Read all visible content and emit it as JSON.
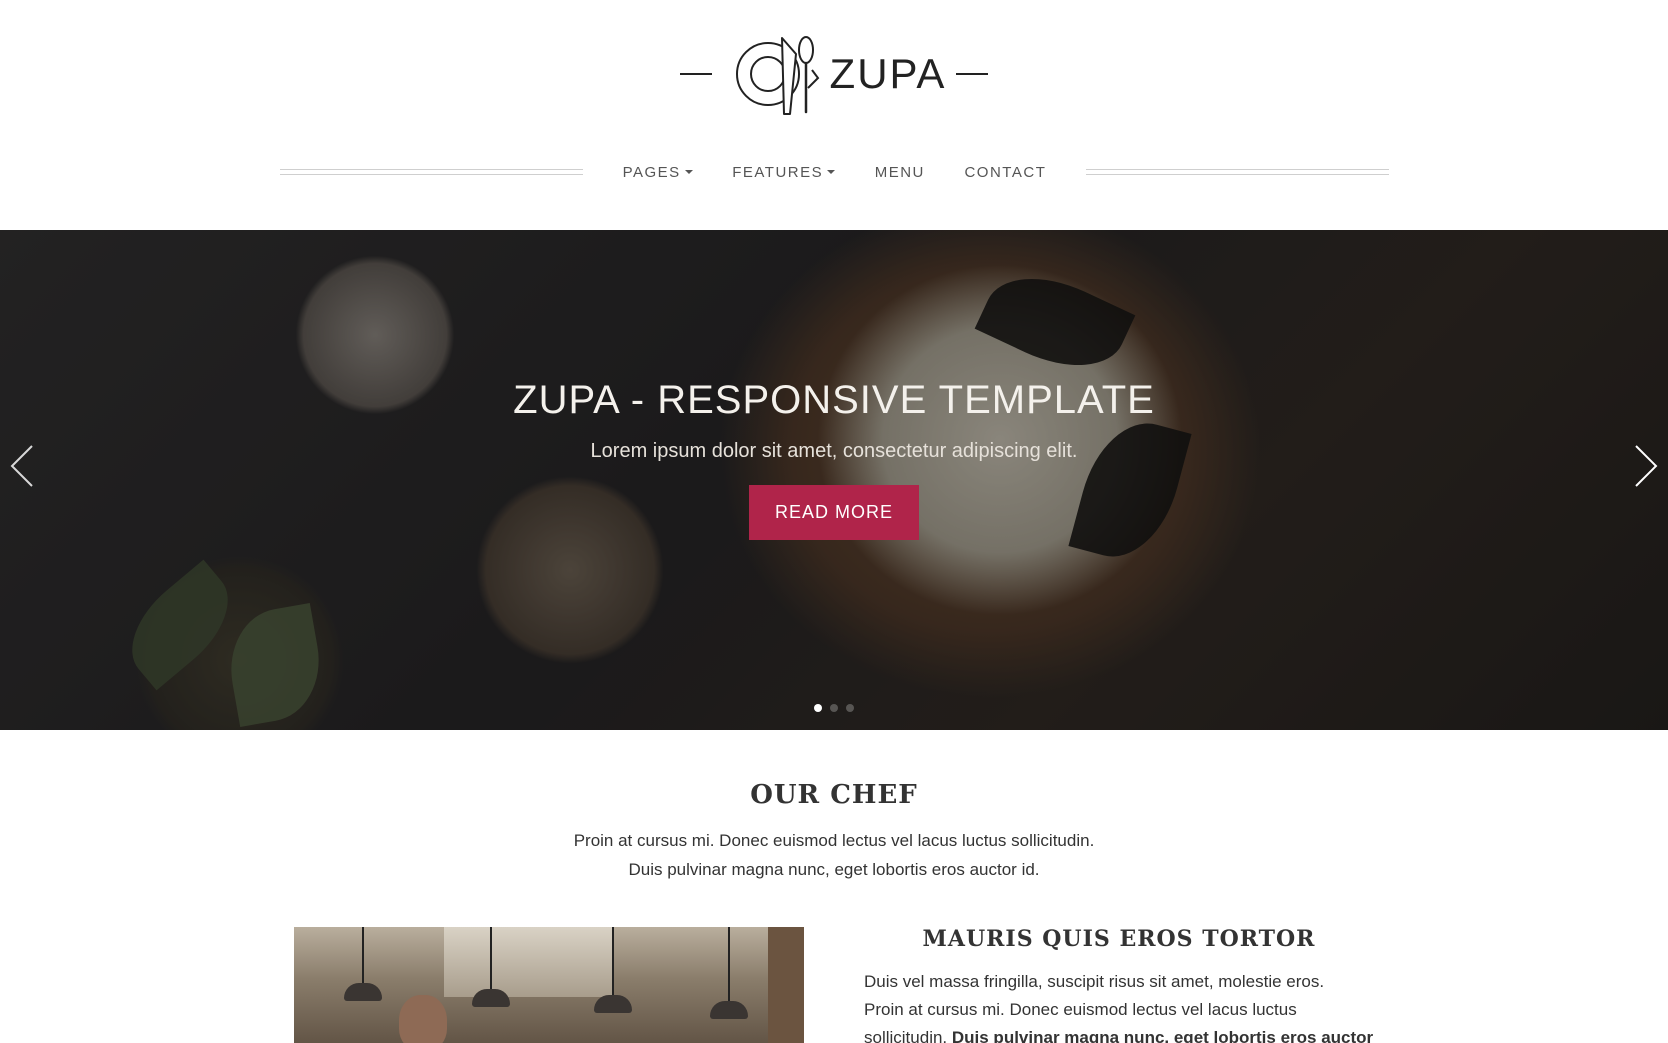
{
  "brand": {
    "name": "ZUPA"
  },
  "nav": {
    "items": [
      {
        "label": "PAGES",
        "dropdown": true
      },
      {
        "label": "FEATURES",
        "dropdown": true
      },
      {
        "label": "MENU",
        "dropdown": false
      },
      {
        "label": "CONTACT",
        "dropdown": false
      }
    ]
  },
  "hero": {
    "title": "ZUPA - RESPONSIVE TEMPLATE",
    "subtitle": "Lorem ipsum dolor sit amet, consectetur adipiscing elit.",
    "button": "READ MORE",
    "slides_total": 3,
    "slide_active": 1
  },
  "chef": {
    "heading": "OUR CHEF",
    "intro_line1": "Proin at cursus mi. Donec euismod lectus vel lacus luctus sollicitudin.",
    "intro_line2": "Duis pulvinar magna nunc, eget lobortis eros auctor id.",
    "subheading": "MAURIS QUIS EROS TORTOR",
    "body_line1": "Duis vel massa fringilla, suscipit risus sit amet, molestie eros.",
    "body_line2": "Proin at cursus mi. Donec euismod lectus vel lacus luctus",
    "body_line3_plain": "sollicitudin. ",
    "body_line3_bold": "Duis pulvinar magna nunc, eget lobortis eros auctor"
  },
  "colors": {
    "accent": "#b0244a",
    "text": "#333333",
    "nav_text": "#555555"
  },
  "icons": [
    "plate-cutlery-logo-icon",
    "chevron-left-icon",
    "chevron-right-icon"
  ]
}
